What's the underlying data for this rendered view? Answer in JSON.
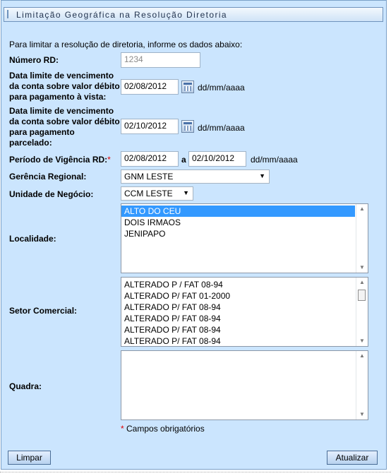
{
  "title": "Limitação Geográfica na Resolução Diretoria",
  "intro": "Para limitar a resolução de diretoria, informe os dados abaixo:",
  "numero_rd": {
    "label": "Número RD:",
    "value": "1234"
  },
  "data_vista": {
    "label_lines": [
      "Data limite de vencimento",
      "da conta sobre valor débito",
      "para pagamento à vista:"
    ],
    "value": "02/08/2012",
    "format": "dd/mm/aaaa"
  },
  "data_parcelado": {
    "label_lines": [
      "Data limite de vencimento",
      "da conta sobre valor débito",
      "para pagamento",
      "parcelado:"
    ],
    "value": "02/10/2012",
    "format": "dd/mm/aaaa"
  },
  "periodo": {
    "label": "Período de Vigência RD:",
    "required_mark": "*",
    "start": "02/08/2012",
    "sep": "a",
    "end": "02/10/2012",
    "format": "dd/mm/aaaa"
  },
  "gerencia": {
    "label": "Gerência Regional:",
    "selected": "GNM LESTE"
  },
  "unidade": {
    "label": "Unidade de Negócio:",
    "selected": "CCM LESTE"
  },
  "localidade": {
    "label": "Localidade:",
    "items": [
      "ALTO DO CEU",
      "DOIS IRMAOS",
      "JENIPAPO"
    ],
    "selected_index": 0
  },
  "setor": {
    "label": "Setor Comercial:",
    "items": [
      "ALTERADO P / FAT 08-94",
      "ALTERADO P/ FAT 01-2000",
      "ALTERADO P/ FAT 08-94",
      "ALTERADO P/ FAT 08-94",
      "ALTERADO P/ FAT 08-94",
      "ALTERADO P/ FAT 08-94"
    ]
  },
  "quadra": {
    "label": "Quadra:",
    "items": []
  },
  "required_note": {
    "mark": "*",
    "text": "Campos obrigatórios"
  },
  "buttons": {
    "limpar": "Limpar",
    "atualizar": "Atualizar"
  },
  "colors": {
    "panel_bg": "#cbe5fe",
    "selection": "#3399ff",
    "required": "#e00000"
  }
}
